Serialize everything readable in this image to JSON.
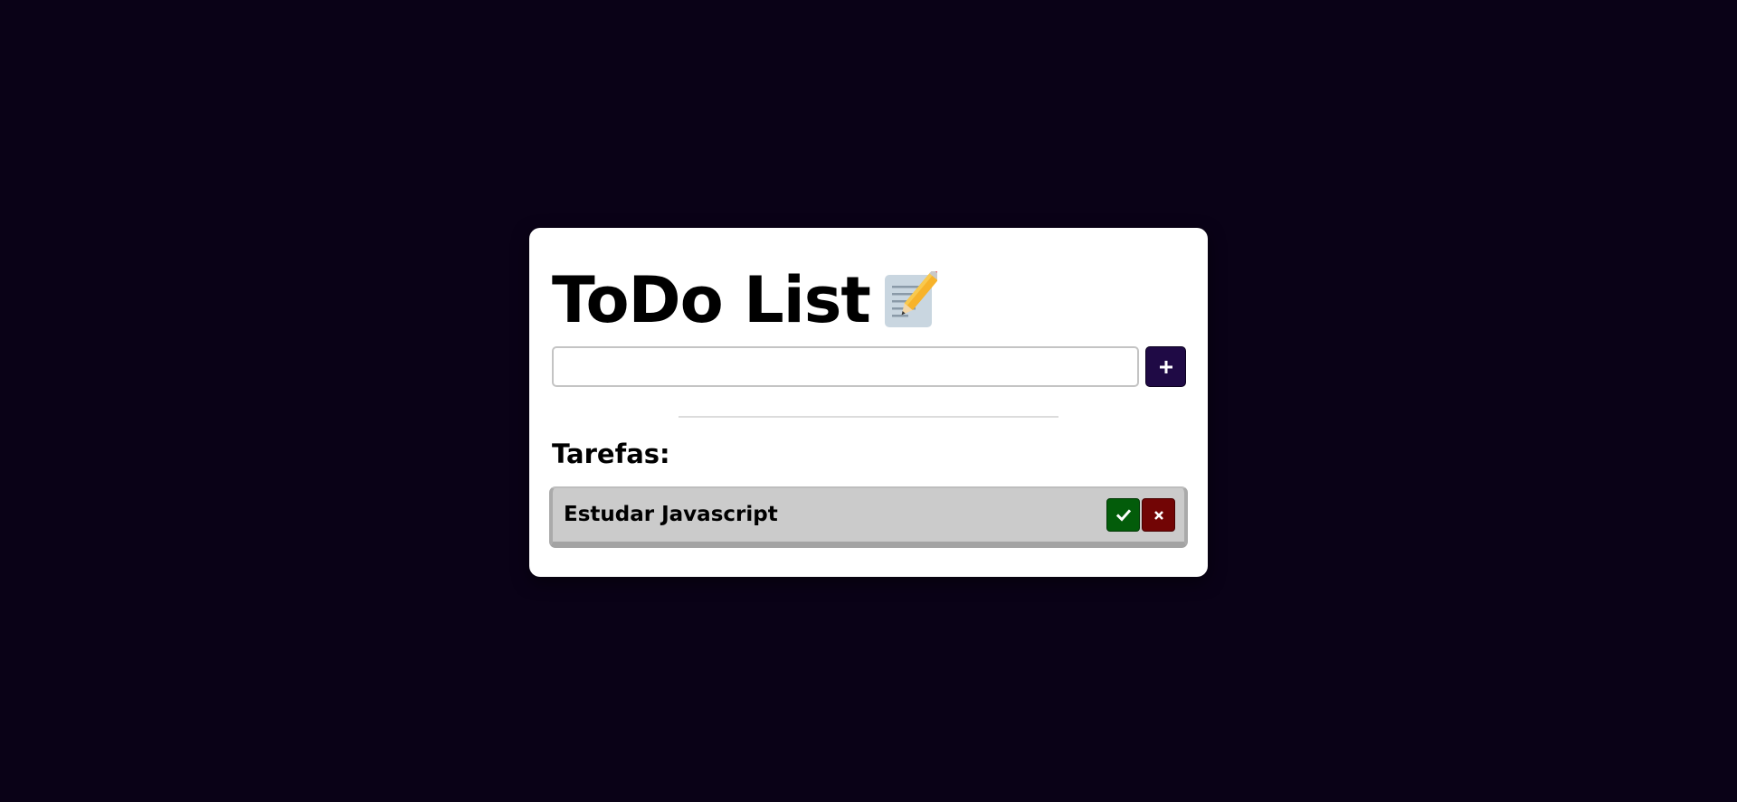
{
  "app": {
    "title": "ToDo List",
    "title_emoji_icon": "memo-pencil-icon"
  },
  "input": {
    "value": "",
    "placeholder": ""
  },
  "add_button": {
    "icon": "plus-icon",
    "label": "+"
  },
  "tasks_section": {
    "title": "Tarefas:"
  },
  "tasks": [
    {
      "text": "Estudar Javascript",
      "done_icon": "check-icon",
      "remove_icon": "close-icon"
    }
  ],
  "colors": {
    "background": "#0a0217",
    "card": "#ffffff",
    "add_button": "#1f0a45",
    "done_button": "#035c0a",
    "remove_button": "#720505",
    "task_item": "#cbcbcb"
  }
}
